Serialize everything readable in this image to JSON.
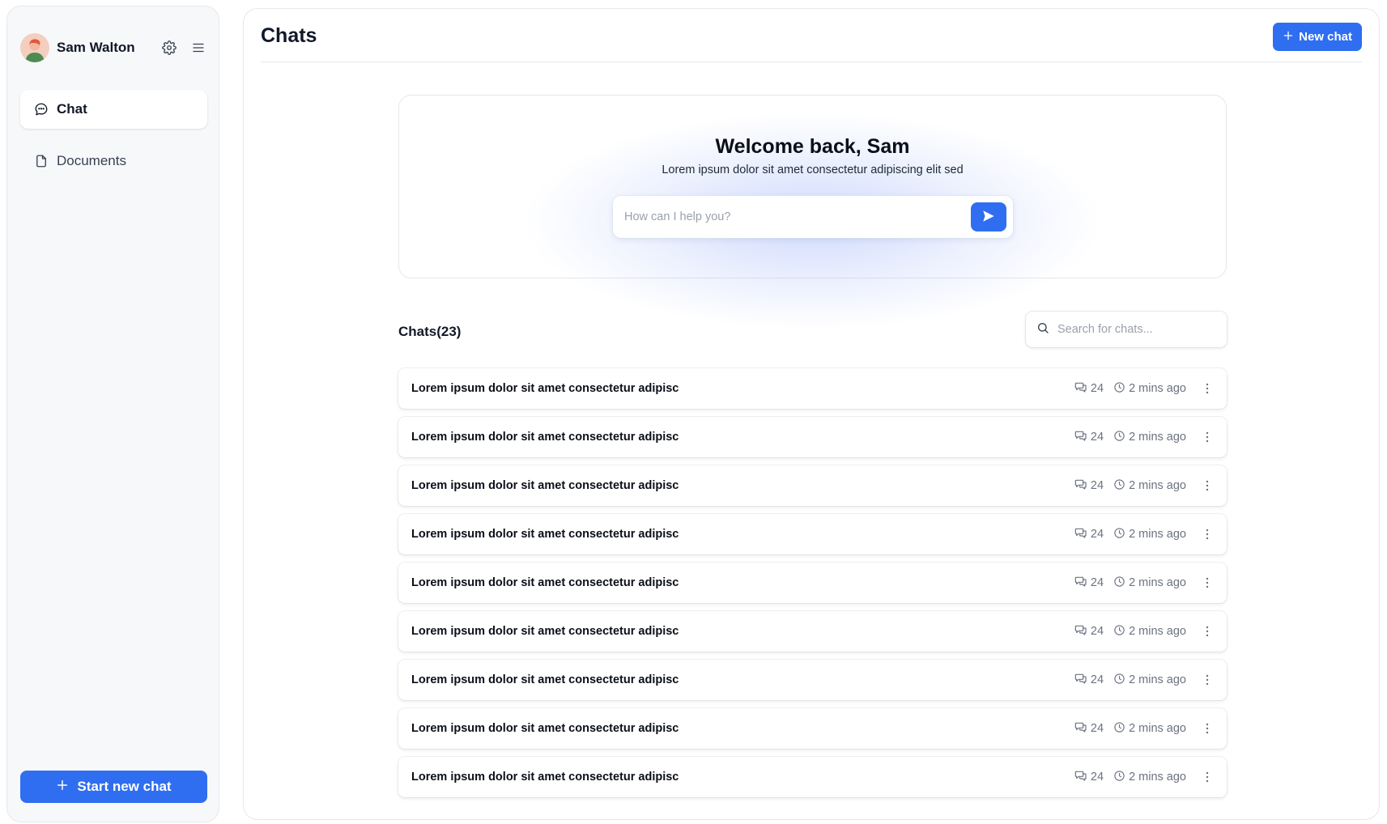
{
  "user": {
    "name": "Sam Walton"
  },
  "sidebar": {
    "items": [
      {
        "label": "Chat",
        "icon": "chat-bubble-icon",
        "active": true
      },
      {
        "label": "Documents",
        "icon": "document-icon",
        "active": false
      }
    ],
    "start_button_label": "Start new chat"
  },
  "header": {
    "title": "Chats",
    "new_chat_label": "New chat"
  },
  "welcome": {
    "title": "Welcome back, Sam",
    "subtitle": "Lorem ipsum dolor sit amet consectetur adipiscing elit sed",
    "prompt_placeholder": "How can I help you?"
  },
  "chats": {
    "heading": "Chats",
    "count": "(23)",
    "search_placeholder": "Search for chats...",
    "items": [
      {
        "title": "Lorem ipsum dolor sit amet consectetur adipisc",
        "messages": "24",
        "time": "2 mins ago"
      },
      {
        "title": "Lorem ipsum dolor sit amet consectetur adipisc",
        "messages": "24",
        "time": "2 mins ago"
      },
      {
        "title": "Lorem ipsum dolor sit amet consectetur adipisc",
        "messages": "24",
        "time": "2 mins ago"
      },
      {
        "title": "Lorem ipsum dolor sit amet consectetur adipisc",
        "messages": "24",
        "time": "2 mins ago"
      },
      {
        "title": "Lorem ipsum dolor sit amet consectetur adipisc",
        "messages": "24",
        "time": "2 mins ago"
      },
      {
        "title": "Lorem ipsum dolor sit amet consectetur adipisc",
        "messages": "24",
        "time": "2 mins ago"
      },
      {
        "title": "Lorem ipsum dolor sit amet consectetur adipisc",
        "messages": "24",
        "time": "2 mins ago"
      },
      {
        "title": "Lorem ipsum dolor sit amet consectetur adipisc",
        "messages": "24",
        "time": "2 mins ago"
      },
      {
        "title": "Lorem ipsum dolor sit amet consectetur adipisc",
        "messages": "24",
        "time": "2 mins ago"
      }
    ]
  },
  "colors": {
    "accent": "#2f6ef0",
    "muted_text": "#6b7280",
    "border": "#e6e8ec"
  }
}
